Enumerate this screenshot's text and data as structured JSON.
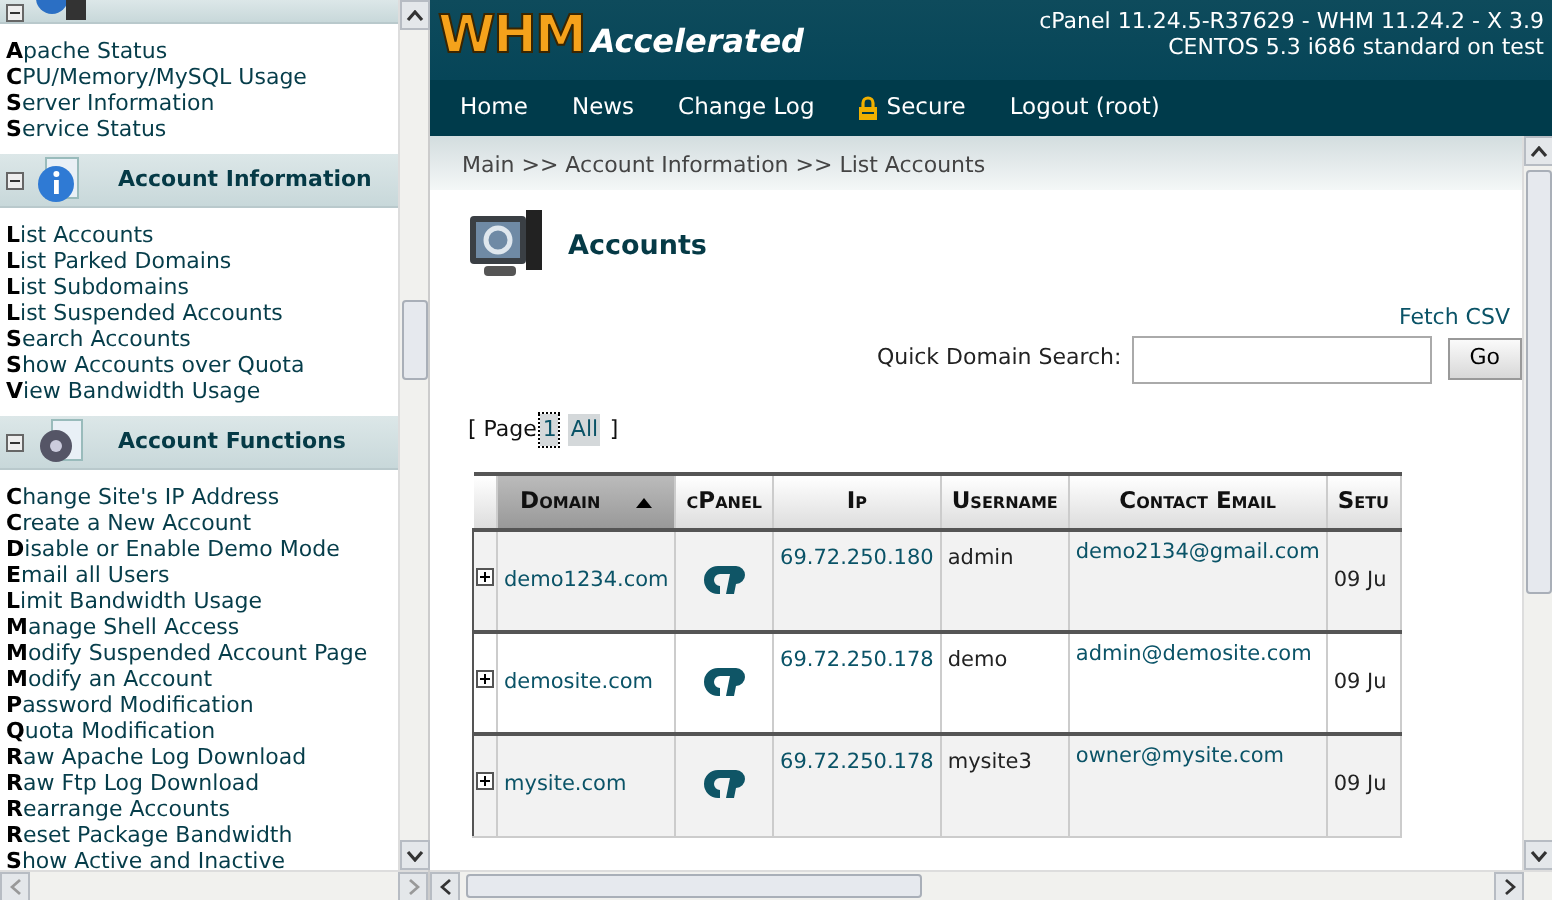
{
  "sidebar": {
    "sections": [
      {
        "expanded": true,
        "items": [
          "**A**pache Status",
          "**C**PU/Memory/MySQL Usage",
          "**S**erver Information",
          "**S**ervice Status"
        ]
      },
      {
        "title": "Account Information",
        "expanded": true,
        "items": [
          "**L**ist Accounts",
          "**L**ist Parked Domains",
          "**L**ist Subdomains",
          "**L**ist Suspended Accounts",
          "**S**earch Accounts",
          "**S**how Accounts over Quota",
          "**V**iew Bandwidth Usage"
        ]
      },
      {
        "title": "Account Functions",
        "expanded": true,
        "items": [
          "**C**hange Site's IP Address",
          "**C**reate a New Account",
          "**D**isable or Enable Demo Mode",
          "**E**mail all Users",
          "**L**imit Bandwidth Usage",
          "**M**anage Shell Access",
          "**M**odify Suspended Account Page",
          "**M**odify an Account",
          "**P**assword Modification",
          "**Q**uota Modification",
          "**R**aw Apache Log Download",
          "**R**aw Ftp Log Download",
          "**R**earrange Accounts",
          "**R**eset Package Bandwidth",
          "**S**how Active and Inactive"
        ]
      }
    ]
  },
  "header": {
    "logo_main": "WHM",
    "logo_sub": "Accelerated",
    "version_lines": [
      "cPanel 11.24.5-R37629 - WHM 11.24.2 - X 3.9",
      "CENTOS 5.3 i686 standard on test"
    ]
  },
  "nav": [
    {
      "label": "Home",
      "kind": "plain"
    },
    {
      "label": "News",
      "kind": "plain"
    },
    {
      "label": "Change Log",
      "kind": "plain"
    },
    {
      "label": "Secure",
      "kind": "lock"
    },
    {
      "label": "Logout (root)",
      "kind": "plain"
    }
  ],
  "breadcrumb": "Main >> Account Information >> List Accounts",
  "page_title": "Accounts",
  "fetch_csv": "Fetch CSV",
  "search": {
    "label": "Quick Domain Search:",
    "button": "Go"
  },
  "pager": {
    "open": "[ Page",
    "links": [
      {
        "label": "1",
        "focused": true
      },
      {
        "label": "All",
        "focused": false
      }
    ],
    "close": "]"
  },
  "table": {
    "columns": [
      {
        "label": "Domain",
        "sorted": true
      },
      {
        "label": "cPanel",
        "sorted": false
      },
      {
        "label": "Ip",
        "sorted": false
      },
      {
        "label": "Username",
        "sorted": false
      },
      {
        "label": "Contact Email",
        "sorted": false
      },
      {
        "label": "Setu",
        "sorted": false
      }
    ],
    "rows": [
      {
        "expanded": false,
        "domain": "demo1234.com",
        "ip": "69.72.250.180",
        "username": "admin",
        "email": "demo2134@gmail.com",
        "setup": "09 Ju"
      },
      {
        "expanded": false,
        "domain": "demosite.com",
        "ip": "69.72.250.178",
        "username": "demo",
        "email": "admin@demosite.com",
        "setup": "09 Ju"
      },
      {
        "expanded": false,
        "domain": "mysite.com",
        "ip": "69.72.250.178",
        "username": "mysite3",
        "email": "owner@mysite.com",
        "setup": "09 Ju"
      }
    ]
  }
}
